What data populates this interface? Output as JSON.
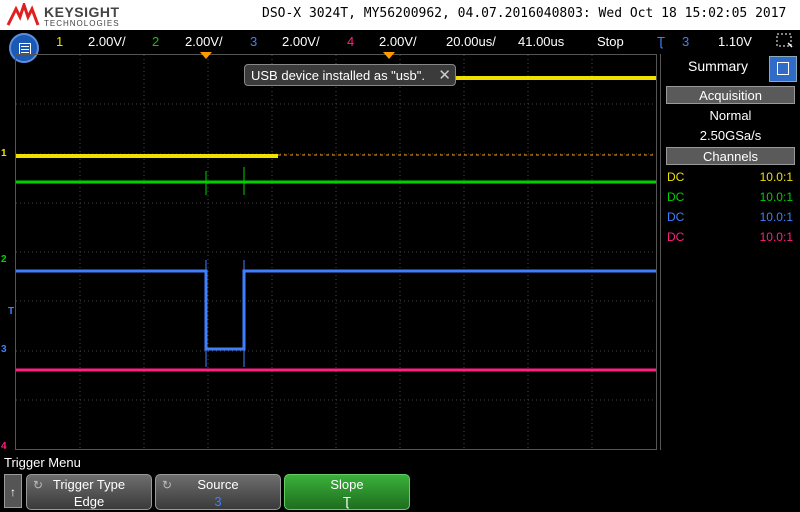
{
  "header": {
    "brand": "KEYSIGHT",
    "brand_sub": "TECHNOLOGIES",
    "model_info": "DSO-X 3024T, MY56200962, 04.07.2016040803: Wed Oct 18 15:02:05 2017"
  },
  "status_bar": {
    "channels": [
      {
        "num": "1",
        "scale": "2.00V/",
        "color": "#f0e000"
      },
      {
        "num": "2",
        "scale": "2.00V/",
        "color": "#00d000"
      },
      {
        "num": "3",
        "scale": "2.00V/",
        "color": "#3f7fff"
      },
      {
        "num": "4",
        "scale": "2.00V/",
        "color": "#ff2080"
      }
    ],
    "timebase": "20.00us/",
    "delay": "41.00us",
    "run_state": "Stop",
    "trigger_symbol": "Ʈ",
    "trigger_source": "3",
    "trigger_level": "1.10V"
  },
  "toast": {
    "message": "USB device installed as \"usb\".",
    "close": "✕"
  },
  "panel": {
    "title": "Summary",
    "acquisition_header": "Acquisition",
    "acq_mode": "Normal",
    "sample_rate": "2.50GSa/s",
    "channels_header": "Channels",
    "channel_rows": [
      {
        "coupling": "DC",
        "probe": "10.0:1",
        "color": "#f0e000"
      },
      {
        "coupling": "DC",
        "probe": "10.0:1",
        "color": "#00d000"
      },
      {
        "coupling": "DC",
        "probe": "10.0:1",
        "color": "#3f7fff"
      },
      {
        "coupling": "DC",
        "probe": "10.0:1",
        "color": "#ff2080"
      }
    ]
  },
  "markers": {
    "ch1": "1",
    "ch2": "2",
    "ch3": "3",
    "ch4": "4",
    "trigger": "T"
  },
  "softkeys": {
    "menu_title": "Trigger Menu",
    "up_arrow": "↑",
    "trigger_type_label": "Trigger Type",
    "trigger_type_value": "Edge",
    "source_label": "Source",
    "source_value": "3",
    "slope_label": "Slope",
    "slope_value": "Ʈ",
    "rotate_symbol": "↻"
  },
  "colors": {
    "ch1": "#f0e000",
    "ch2": "#00d000",
    "ch3": "#3f7fff",
    "ch4": "#ff2080",
    "trigger": "#ff9900"
  }
}
